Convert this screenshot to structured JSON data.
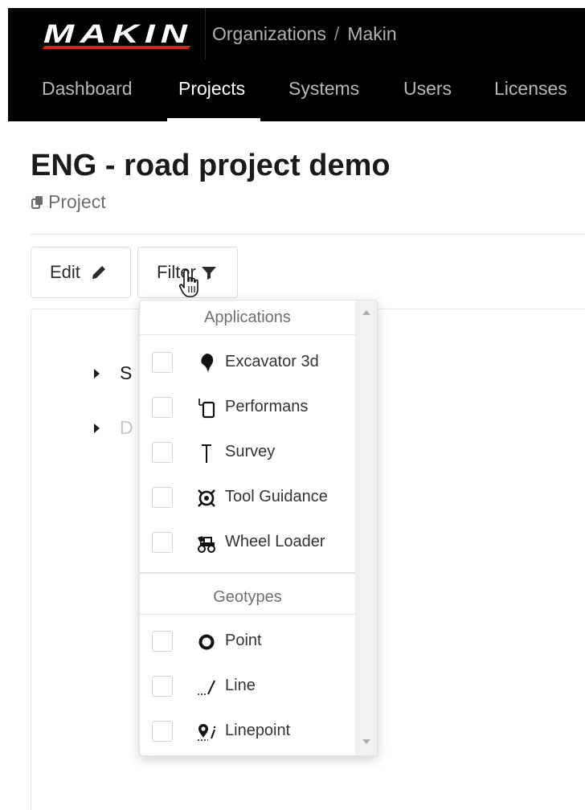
{
  "header": {
    "logo_text": "MAKIN",
    "breadcrumb": [
      "Organizations",
      "Makin"
    ],
    "breadcrumb_separator": "/",
    "nav": [
      {
        "label": "Dashboard",
        "active": false
      },
      {
        "label": "Projects",
        "active": true
      },
      {
        "label": "Systems",
        "active": false
      },
      {
        "label": "Users",
        "active": false
      },
      {
        "label": "Licenses",
        "active": false
      }
    ]
  },
  "page": {
    "title": "ENG - road project demo",
    "subtitle": "Project"
  },
  "toolbar": {
    "edit_label": "Edit",
    "filter_label": "Filter"
  },
  "tree": {
    "items": [
      {
        "label": "S"
      },
      {
        "label": "D"
      }
    ]
  },
  "filter_dropdown": {
    "applications_header": "Applications",
    "applications": [
      {
        "label": "Excavator 3d",
        "icon": "excavator-icon",
        "checked": false
      },
      {
        "label": "Performans",
        "icon": "performans-icon",
        "checked": false
      },
      {
        "label": "Survey",
        "icon": "survey-icon",
        "checked": false
      },
      {
        "label": "Tool Guidance",
        "icon": "tool-guidance-icon",
        "checked": false
      },
      {
        "label": "Wheel Loader",
        "icon": "wheel-loader-icon",
        "checked": false
      }
    ],
    "geotypes_header": "Geotypes",
    "geotypes": [
      {
        "label": "Point",
        "icon": "point-icon",
        "checked": false
      },
      {
        "label": "Line",
        "icon": "line-icon",
        "checked": false
      },
      {
        "label": "Linepoint",
        "icon": "linepoint-icon",
        "checked": false
      }
    ]
  },
  "colors": {
    "header_bg": "#000000",
    "logo_red": "#e0201f",
    "nav_active": "#ffffff",
    "nav_inactive": "#b8b8b8"
  }
}
